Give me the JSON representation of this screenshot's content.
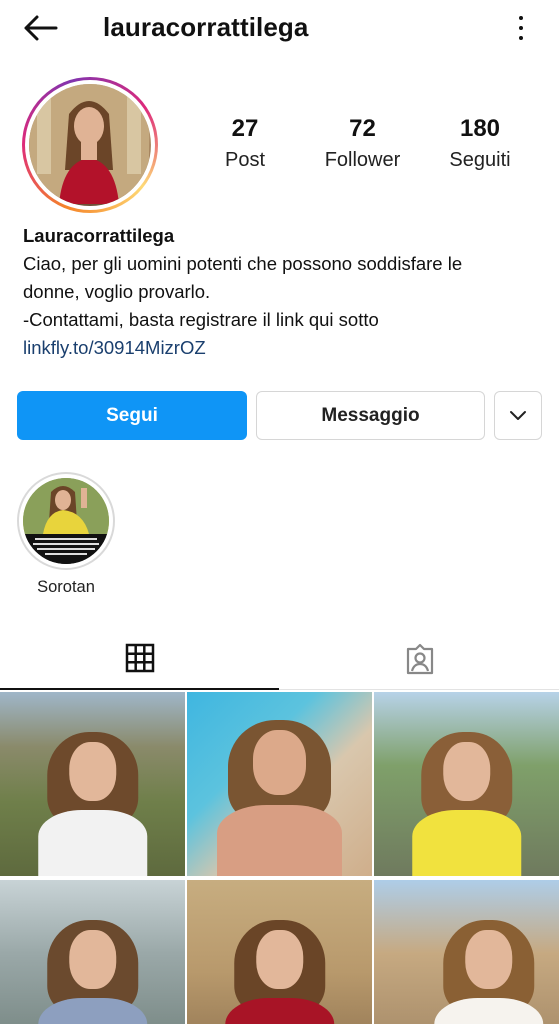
{
  "header": {
    "username": "lauracorrattilega"
  },
  "profile": {
    "stats": [
      {
        "value": "27",
        "label": "Post"
      },
      {
        "value": "72",
        "label": "Follower"
      },
      {
        "value": "180",
        "label": "Seguiti"
      }
    ],
    "display_name": "Lauracorrattilega",
    "bio_lines": [
      "Ciao, per gli uomini potenti che possono soddisfare le",
      "donne, voglio provarlo.",
      "-Contattami, basta registrare il link qui sotto"
    ],
    "link": "linkfly.to/30914MizrOZ"
  },
  "actions": {
    "follow_label": "Segui",
    "message_label": "Messaggio"
  },
  "highlights": [
    {
      "label": "Sorotan"
    }
  ],
  "colors": {
    "follow_button": "#0f95f6",
    "link": "#1a3f6e",
    "story_ring_start": "#f58529",
    "story_ring_end": "#dd2a7b"
  },
  "icons": {
    "back": "back-arrow-icon",
    "more": "more-vertical-icon",
    "dropdown": "chevron-down-icon",
    "grid_tab": "grid-icon",
    "tagged_tab": "tagged-person-icon"
  }
}
